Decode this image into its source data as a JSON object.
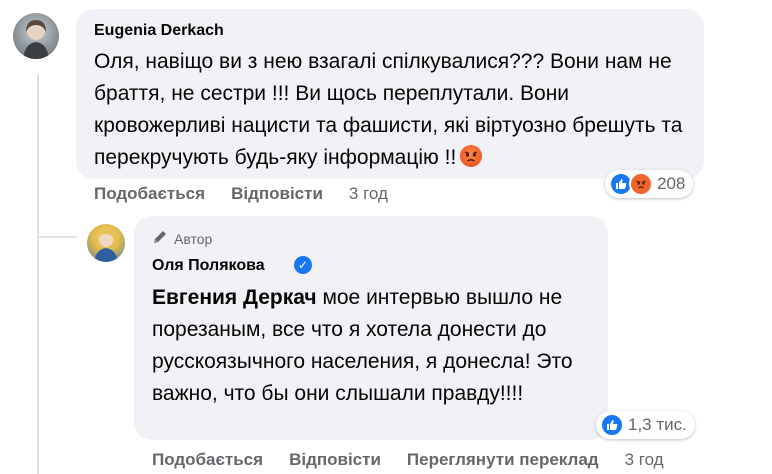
{
  "comments": [
    {
      "author": "Eugenia Derkach",
      "text": "Оля, навіщо ви з нею взагалі спілкувалися??? Вони нам не браття, не сестри !!! Ви щось переплутали. Вони кровожерливі нацисти та фашисти, які віртуозно брешуть та перекручують будь-яку інформацію !!",
      "reaction_count": "208",
      "reactions": [
        "like-icon",
        "angry-icon"
      ],
      "actions": {
        "like": "Подобається",
        "reply": "Відповісти",
        "time": "3 год"
      }
    },
    {
      "badge": "Автор",
      "author": "Оля Полякова",
      "mention": "Евгения Деркач",
      "text": " мое интервью вышло не порезаным, все что я хотела донести до русскоязычного населения, я донесла! Это важно, что бы они слышали правду!!!!",
      "reaction_count": "1,3 тис.",
      "reactions": [
        "like-icon"
      ],
      "actions": {
        "like": "Подобається",
        "reply": "Відповісти",
        "translate": "Переглянути переклад",
        "time": "3 год"
      }
    }
  ],
  "colors": {
    "bubble": "#f0f2f5",
    "meta": "#65676b",
    "like": "#1877f2",
    "angry": "#f0642e"
  }
}
